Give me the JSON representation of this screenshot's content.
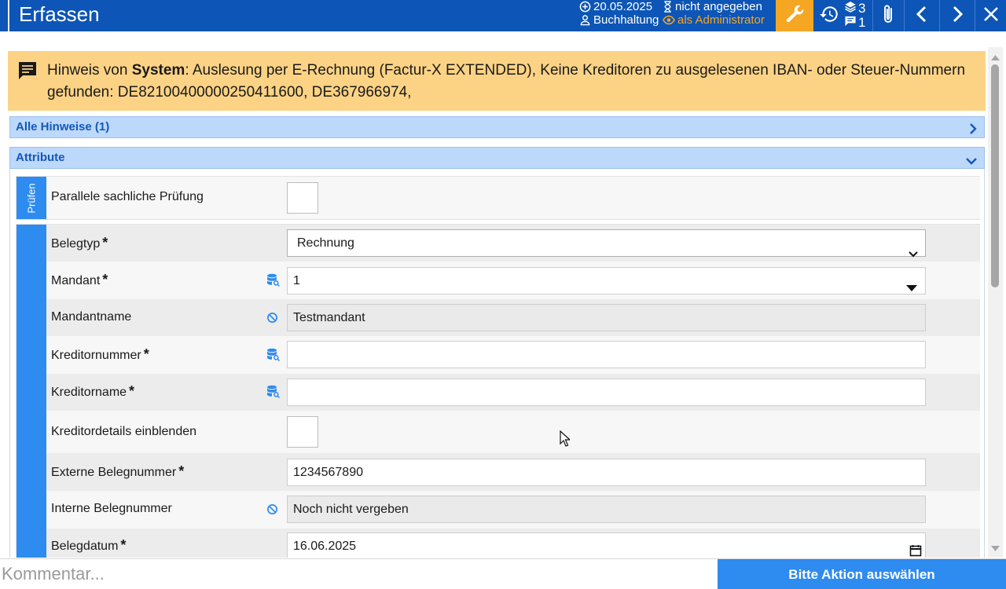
{
  "header": {
    "title": "Erfassen",
    "date": "20.05.2025",
    "department": "Buchhaltung",
    "assignee": "nicht angegeben",
    "role": "als Administrator",
    "stack_count": "3",
    "comment_count": "1"
  },
  "notice": {
    "prefix": "Hinweis von ",
    "source": "System",
    "message": ": Auslesung per E-Rechnung (Factur-X EXTENDED), Keine Kreditoren zu ausgelesenen IBAN- oder Steuer-Nummern gefunden: DE82100400000250411600, DE367966974,"
  },
  "sections": {
    "hinweise": "Alle Hinweise (1)",
    "attribute": "Attribute"
  },
  "groups": {
    "pruefen_tab": "Prüfen"
  },
  "fields": {
    "parallel_check": {
      "label": "Parallele sachliche Prüfung",
      "checked": false
    },
    "belegtyp": {
      "label": "Belegtyp",
      "value": "Rechnung",
      "required": "*"
    },
    "mandant": {
      "label": "Mandant",
      "value": "1",
      "required": "*"
    },
    "mandantname": {
      "label": "Mandantname",
      "value": "Testmandant"
    },
    "kreditornummer": {
      "label": "Kreditornummer",
      "value": "",
      "required": "*"
    },
    "kreditorname": {
      "label": "Kreditorname",
      "value": "",
      "required": "*"
    },
    "kreditordetails": {
      "label": "Kreditordetails einblenden",
      "checked": false
    },
    "externe_belegnummer": {
      "label": "Externe Belegnummer",
      "value": "1234567890",
      "required": "*"
    },
    "interne_belegnummer": {
      "label": "Interne Belegnummer",
      "value": "Noch nicht vergeben"
    },
    "belegdatum": {
      "label": "Belegdatum",
      "value": "16.06.2025",
      "required": "*"
    }
  },
  "footer": {
    "comment_placeholder": "Kommentar...",
    "action_label": "Bitte Aktion auswählen"
  },
  "colors": {
    "header_bg": "#0d55b6",
    "accent_orange": "#f5a623",
    "accent_blue": "#2e8bf0",
    "notice_bg": "#fcd385",
    "section_bg": "#bcd8fb"
  }
}
